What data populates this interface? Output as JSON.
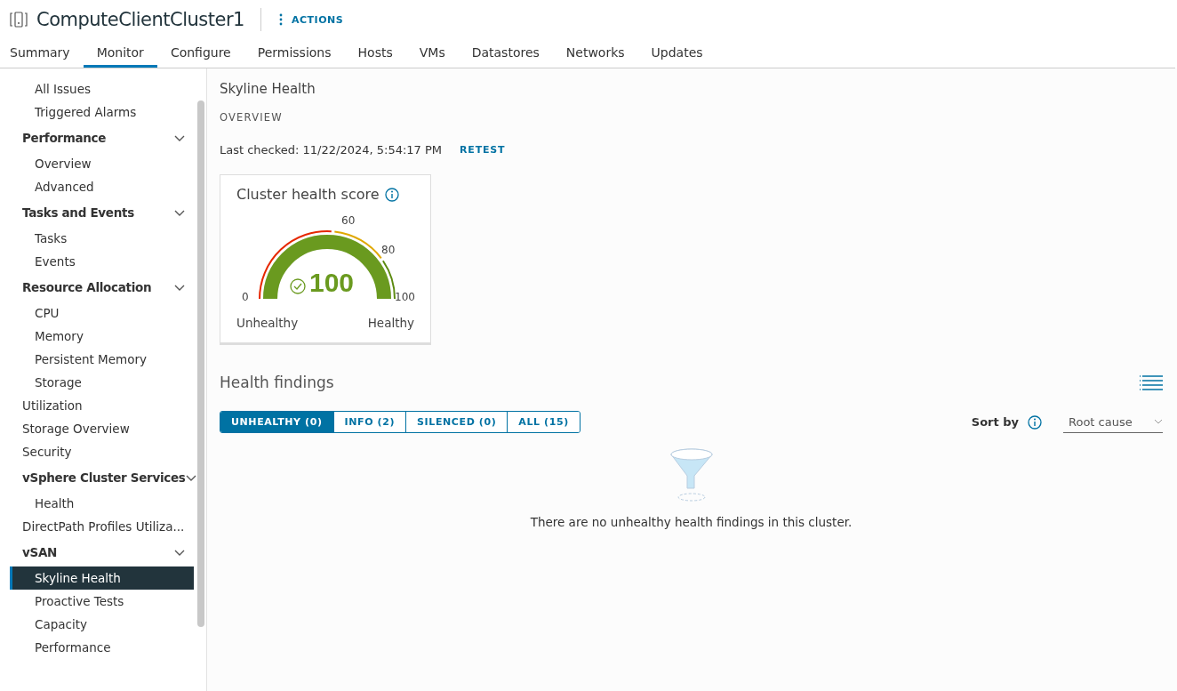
{
  "header": {
    "title": "ComputeClientCluster1",
    "actions_label": "ACTIONS"
  },
  "tabs": [
    {
      "label": "Summary",
      "selected": false
    },
    {
      "label": "Monitor",
      "selected": true
    },
    {
      "label": "Configure",
      "selected": false
    },
    {
      "label": "Permissions",
      "selected": false
    },
    {
      "label": "Hosts",
      "selected": false
    },
    {
      "label": "VMs",
      "selected": false
    },
    {
      "label": "Datastores",
      "selected": false
    },
    {
      "label": "Networks",
      "selected": false
    },
    {
      "label": "Updates",
      "selected": false
    }
  ],
  "sidebar": {
    "items": [
      {
        "kind": "continued",
        "children": [
          {
            "label": "All Issues",
            "selected": false
          },
          {
            "label": "Triggered Alarms",
            "selected": false
          }
        ]
      },
      {
        "kind": "group",
        "label": "Performance",
        "expanded": true,
        "children": [
          {
            "label": "Overview",
            "selected": false
          },
          {
            "label": "Advanced",
            "selected": false
          }
        ]
      },
      {
        "kind": "group",
        "label": "Tasks and Events",
        "expanded": true,
        "children": [
          {
            "label": "Tasks",
            "selected": false
          },
          {
            "label": "Events",
            "selected": false
          }
        ]
      },
      {
        "kind": "group",
        "label": "Resource Allocation",
        "expanded": true,
        "children": [
          {
            "label": "CPU",
            "selected": false
          },
          {
            "label": "Memory",
            "selected": false
          },
          {
            "label": "Persistent Memory",
            "selected": false
          },
          {
            "label": "Storage",
            "selected": false
          }
        ]
      },
      {
        "kind": "item",
        "label": "Utilization",
        "selected": false
      },
      {
        "kind": "item",
        "label": "Storage Overview",
        "selected": false
      },
      {
        "kind": "item",
        "label": "Security",
        "selected": false
      },
      {
        "kind": "group",
        "label": "vSphere Cluster Services",
        "expanded": true,
        "children": [
          {
            "label": "Health",
            "selected": false
          }
        ]
      },
      {
        "kind": "item",
        "label": "DirectPath Profiles Utiliza...",
        "selected": false
      },
      {
        "kind": "group",
        "label": "vSAN",
        "expanded": true,
        "children": [
          {
            "label": "Skyline Health",
            "selected": true
          },
          {
            "label": "Proactive Tests",
            "selected": false
          },
          {
            "label": "Capacity",
            "selected": false
          },
          {
            "label": "Performance",
            "selected": false
          }
        ]
      }
    ]
  },
  "content": {
    "title": "Skyline Health",
    "section": "OVERVIEW",
    "last_checked": "Last checked: 11/22/2024, 5:54:17 PM",
    "retest": "RETEST",
    "score_card": {
      "title": "Cluster health score",
      "score": "100",
      "level": 1,
      "ticks": [
        "0",
        "60",
        "80",
        "100"
      ],
      "low_label": "Unhealthy",
      "high_label": "Healthy"
    },
    "findings": {
      "title": "Health findings",
      "filters": [
        {
          "label": "UNHEALTHY (0)",
          "selected": true
        },
        {
          "label": "INFO (2)",
          "selected": false
        },
        {
          "label": "SILENCED (0)",
          "selected": false
        },
        {
          "label": "ALL (15)",
          "selected": false
        }
      ],
      "sort_label": "Sort by",
      "sort_value": "Root cause",
      "empty_message": "There are no unhealthy health findings in this cluster."
    }
  }
}
